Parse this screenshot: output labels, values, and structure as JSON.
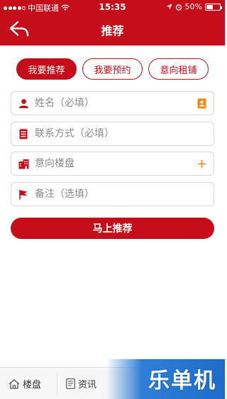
{
  "status_bar": {
    "carrier": "中国联通",
    "time": "15:35",
    "battery_percent": "50%",
    "battery_level": 0.5
  },
  "nav": {
    "title": "推荐"
  },
  "tabs": [
    {
      "label": "我要推荐",
      "active": true
    },
    {
      "label": "我要预约",
      "active": false
    },
    {
      "label": "意向租铺",
      "active": false
    }
  ],
  "form": {
    "name_placeholder": "姓名（必填）",
    "contact_placeholder": "联系方式（必填）",
    "building_placeholder": "意向楼盘",
    "note_placeholder": "备注（选填）",
    "submit_label": "马上推荐"
  },
  "tab_bar": {
    "items": [
      {
        "label": "楼盘"
      },
      {
        "label": "资讯"
      }
    ]
  },
  "brand": {
    "text": "乐单机"
  },
  "colors": {
    "accent": "#c50e1a",
    "field_icon": "#c50e1a",
    "contact_icon": "#f08a1c"
  }
}
